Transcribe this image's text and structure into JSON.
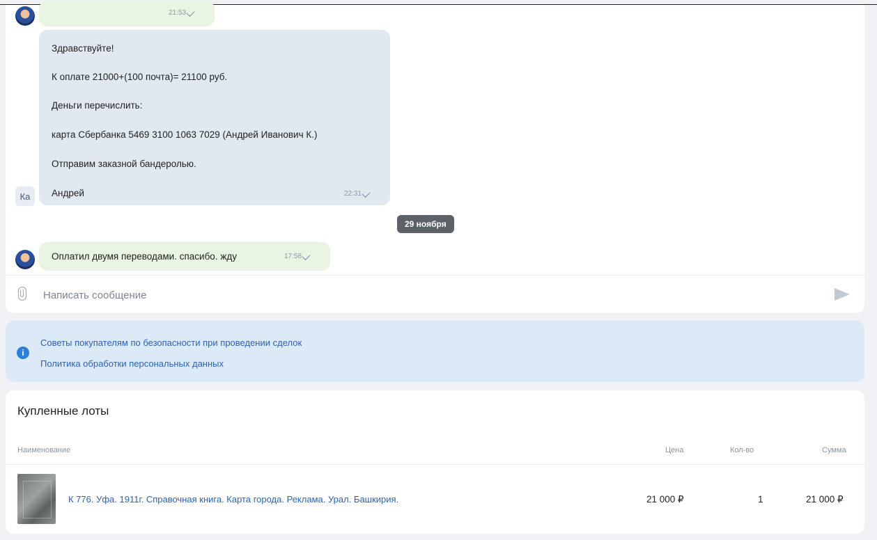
{
  "chat": {
    "messages": [
      {
        "direction": "out",
        "text_lines": [],
        "time": "21:53"
      },
      {
        "direction": "in",
        "sender_initials": "Ка",
        "text_lines": [
          "Здравствуйте!",
          "К оплате 21000+(100 почта)= 21100 руб.",
          "Деньги перечислить:",
          "карта Сбербанка 5469 3100 1063 7029 (Андрей Иванович К.)",
          "Отправим заказной бандеролью.",
          "Андрей"
        ],
        "time": "22:31"
      },
      {
        "direction": "out",
        "text_lines": [
          "Оплатил двумя переводами. спасибо. жду"
        ],
        "time": "17:58"
      }
    ],
    "date_divider": "29 ноября"
  },
  "composer": {
    "placeholder": "Написать сообщение",
    "value": ""
  },
  "info": {
    "links": [
      "Советы покупателям по безопасности при проведении сделок",
      "Политика обработки персональных данных"
    ]
  },
  "lots": {
    "title": "Купленные лоты",
    "columns": [
      "Наименование",
      "Цена",
      "Кол-во",
      "Сумма"
    ],
    "rows": [
      {
        "name": "К 776. Уфа. 1911г. Справочная книга. Карта города. Реклама. Урал. Башкирия.",
        "price": "21 000 ₽",
        "qty": "1",
        "sum": "21 000 ₽"
      }
    ]
  },
  "colors": {
    "outgoing_bubble": "#e9f4e3",
    "incoming_bubble": "#e2e8f0",
    "link": "#2d62b0",
    "info_panel": "#dce9f6",
    "date_pill": "#5d6268"
  }
}
